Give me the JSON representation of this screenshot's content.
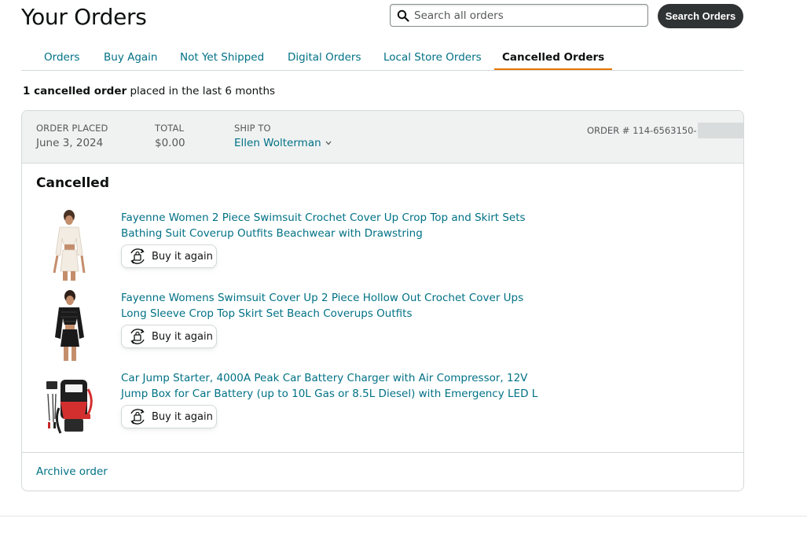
{
  "header": {
    "title": "Your Orders",
    "search_placeholder": "Search all orders",
    "search_button": "Search Orders"
  },
  "tabs": [
    {
      "label": "Orders",
      "active": false
    },
    {
      "label": "Buy Again",
      "active": false
    },
    {
      "label": "Not Yet Shipped",
      "active": false
    },
    {
      "label": "Digital Orders",
      "active": false
    },
    {
      "label": "Local Store Orders",
      "active": false
    },
    {
      "label": "Cancelled Orders",
      "active": true
    }
  ],
  "summary": {
    "count_text": "1 cancelled order",
    "rest_text": " placed in the last 6 months"
  },
  "order": {
    "placed_label": "ORDER PLACED",
    "placed_value": "June 3, 2024",
    "total_label": "TOTAL",
    "total_value": "$0.00",
    "ship_label": "SHIP TO",
    "ship_value": "Ellen Wolterman",
    "order_number": "ORDER # 114-6563150-",
    "status": "Cancelled",
    "items": [
      {
        "title": "Fayenne Women 2 Piece Swimsuit Crochet Cover Up Crop Top and Skirt Sets Bathing Suit Coverup Outfits Beachwear with Drawstring",
        "button": "Buy it again"
      },
      {
        "title": "Fayenne Womens Swimsuit Cover Up 2 Piece Hollow Out Crochet Cover Ups Long Sleeve Crop Top Skirt Set Beach Coverups Outfits",
        "button": "Buy it again"
      },
      {
        "title": "Car Jump Starter, 4000A Peak Car Battery Charger with Air Compressor, 12V Jump Box for Car Battery (up to 10L Gas or 8.5L Diesel) with Emergency LED L",
        "button": "Buy it again"
      }
    ],
    "archive_link": "Archive order"
  },
  "colors": {
    "link": "#007185",
    "active_tab_underline": "#e77600",
    "header_bg": "#f0f2f2",
    "search_button_bg": "#303333"
  }
}
